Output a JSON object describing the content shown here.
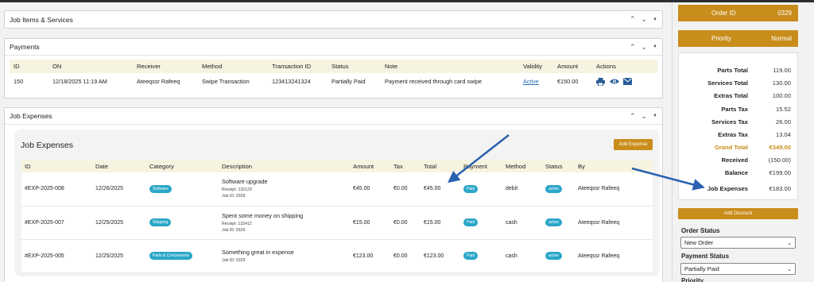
{
  "panels": {
    "job_items": {
      "title": "Job Items & Services"
    },
    "payments": {
      "title": "Payments",
      "columns": [
        "ID",
        "ON",
        "Receiver",
        "Method",
        "Transaction ID",
        "Status",
        "Note",
        "Validity",
        "Amount",
        "Actions"
      ],
      "row": {
        "id": "150",
        "on": "12/18/2025 11:19 AM",
        "receiver": "Ateeqssr Rafeeq",
        "method": "Swipe Transaction",
        "transaction_id": "123413241324",
        "status": "Partially Paid",
        "note": "Payment received through card swipe",
        "validity": "Active",
        "amount": "€150.00"
      }
    },
    "job_expenses": {
      "title": "Job Expenses",
      "inner_title": "Job Expenses",
      "add_button": "Add Expense",
      "columns": [
        "ID",
        "Date",
        "Category",
        "Description",
        "Amount",
        "Tax",
        "Total",
        "Payment",
        "Method",
        "Status",
        "By"
      ],
      "rows": [
        {
          "id": "#EXP-2025-008",
          "date": "12/26/2025",
          "category": "Software",
          "desc": "Software upgrade",
          "receipt": "Receipt: 132123",
          "job": "Job ID: 0329",
          "amount": "€45.00",
          "tax": "€0.00",
          "total": "€45.00",
          "payment": "Paid",
          "method": "debit",
          "status": "active",
          "by": "Ateeqssr Rafeeq"
        },
        {
          "id": "#EXP-2025-007",
          "date": "12/25/2025",
          "category": "Shipping",
          "desc": "Spent some money on shipping",
          "receipt": "Receipt: 132412",
          "job": "Job ID: 0329",
          "amount": "€15.00",
          "tax": "€0.00",
          "total": "€15.00",
          "payment": "Paid",
          "method": "cash",
          "status": "active",
          "by": "Ateeqssr Rafeeq"
        },
        {
          "id": "#EXP-2025-005",
          "date": "12/25/2025",
          "category": "Parts & Components",
          "desc": "Something great in expense",
          "receipt": "",
          "job": "Job ID: 0329",
          "amount": "€123.00",
          "tax": "€0.00",
          "total": "€123.00",
          "payment": "Paid",
          "method": "cash",
          "status": "active",
          "by": "Ateeqssr Rafeeq"
        }
      ]
    }
  },
  "sidebar": {
    "order_id_label": "Order ID",
    "order_id": "0329",
    "priority_label": "Priority",
    "priority": "Normal",
    "totals": [
      {
        "label": "Parts Total",
        "value": "119.00"
      },
      {
        "label": "Services Total",
        "value": "130.00"
      },
      {
        "label": "Extras Total",
        "value": "100.00"
      },
      {
        "label": "Parts Tax",
        "value": "15.52"
      },
      {
        "label": "Services Tax",
        "value": "26.00"
      },
      {
        "label": "Extras Tax",
        "value": "13.04"
      },
      {
        "label": "Grand Total",
        "value": "€349.00"
      },
      {
        "label": "Received",
        "value": "(150.00)"
      },
      {
        "label": "Balance",
        "value": "€199.00"
      },
      {
        "label": "Job Expenses",
        "value": "€183.00"
      }
    ],
    "add_discount": "Add Discount",
    "order_status_label": "Order Status",
    "order_status": "New Order",
    "payment_status_label": "Payment Status",
    "payment_status": "Partially Paid",
    "priority_field_label": "Priority"
  },
  "colors": {
    "accent": "#c98d1c",
    "pill": "#2aa6c8",
    "arrow": "#2a62b0",
    "header_bg": "#f6f3e0"
  },
  "icons": [
    "chevron-up-icon",
    "chevron-down-icon",
    "caret-down-icon",
    "print-icon",
    "eye-icon",
    "envelope-icon",
    "arrow-icon"
  ]
}
